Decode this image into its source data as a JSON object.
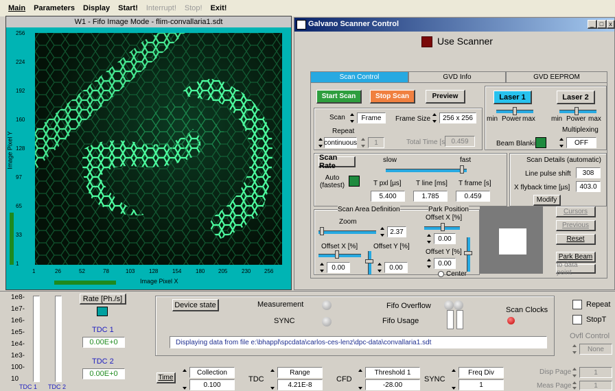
{
  "menu": {
    "items": [
      "Main",
      "Parameters",
      "Display",
      "Start!",
      "Interrupt!",
      "Stop!",
      "Exit!"
    ],
    "disabled": [
      false,
      false,
      false,
      false,
      true,
      true,
      false
    ]
  },
  "image_window": {
    "title": "W1 -  Fifo Image Mode - flim-convallaria1.sdt",
    "y_axis_label": "Image Pixel Y",
    "x_axis_label": "Image Pixel X",
    "y_ticks": [
      "256",
      "224",
      "192",
      "160",
      "128",
      "97",
      "65",
      "33",
      "1"
    ],
    "x_ticks": [
      "1",
      "26",
      "52",
      "78",
      "103",
      "128",
      "154",
      "180",
      "205",
      "230",
      "256"
    ]
  },
  "scanner_window": {
    "title": "Galvano Scanner Control",
    "use_scanner": "Use Scanner",
    "tabs": [
      "Scan Control",
      "GVD Info",
      "GVD EEPROM"
    ],
    "start_scan": "Start Scan",
    "stop_scan": "Stop Scan",
    "preview": "Preview",
    "scan_label": "Scan",
    "scan_mode": "Frame",
    "frame_size_label": "Frame Size",
    "frame_size": "256 x 256",
    "repeat_label": "Repeat",
    "repeat_mode": "continuous",
    "repeat_count": "1",
    "total_time_label": "Total Time [s]",
    "total_time": "0.459",
    "laser1": "Laser 1",
    "laser2": "Laser 2",
    "power_min": "min",
    "power_label": "Power",
    "power_max": "max",
    "multiplexing_label": "Multiplexing",
    "multiplexing": "OFF",
    "beam_blanking": "Beam Blanking",
    "scan_rate": "Scan Rate",
    "slow": "slow",
    "fast": "fast",
    "auto_label": "Auto\n(fastest)",
    "tpxl_label": "T pxl [µs]",
    "tline_label": "T line [ms]",
    "tframe_label": "T frame [s]",
    "tpxl": "5.400",
    "tline": "1.785",
    "tframe": "0.459",
    "scan_details_title": "Scan Details (automatic)",
    "line_pulse_shift_label": "Line pulse shift",
    "line_pulse_shift": "308",
    "xflyback_label": "X flyback time [µs]",
    "xflyback": "403.0",
    "modify": "Modify",
    "scan_area_title": "Scan Area Definition",
    "zoom_label": "Zoom",
    "zoom": "2.37",
    "offset_x_label": "Offset X [%]",
    "offset_y_label": "Offset Y [%]",
    "offset_x": "0.00",
    "offset_y": "0.00",
    "park_position_title": "Park Position",
    "park_offset_x_label": "Offset X [%]",
    "park_offset_x": "0.00",
    "park_offset_y_label": "Offset Y [%]",
    "park_offset_y": "0.00",
    "center_label": "Center",
    "cursors": "Cursors",
    "previous": "Previous",
    "reset": "Reset",
    "park_beam": "Park Beam",
    "to_data_point": "to data point"
  },
  "bottom": {
    "rate_ticks": [
      "1e8-",
      "1e7-",
      "1e6-",
      "1e5-",
      "1e4-",
      "1e3-",
      "100-",
      "10"
    ],
    "tdc1_label": "TDC 1",
    "tdc2_label": "TDC 2",
    "rate_label": "Rate [Ph./s]",
    "tdc1_value": "0.00E+0",
    "tdc2_value": "0.00E+0",
    "device_state": "Device state",
    "measurement": "Measurement",
    "sync": "SYNC",
    "fifo_overflow": "Fifo Overflow",
    "fifo_usage": "Fifo Usage",
    "scan_clocks": "Scan Clocks",
    "status_message": "Displaying data from file e:\\bhappl\\spcdata\\carlos-ces-lenz\\dpc-data\\convallaria1.sdt",
    "repeat": "Repeat",
    "stopt": "StopT",
    "ovfl_control_label": "Ovfl Control",
    "ovfl_control": "None",
    "time_label": "Time",
    "collection_label": "Collection",
    "collection_value": "0.100",
    "tdc_label": "TDC",
    "range_label": "Range",
    "range_value": "4.21E-8",
    "cfd_label": "CFD",
    "threshold_label": "Threshold 1",
    "threshold_value": "-28.00",
    "sync_label": "SYNC",
    "freq_div_label": "Freq Div",
    "freq_div_value": "1",
    "disp_page_label": "Disp Page",
    "disp_page": "1",
    "meas_page_label": "Meas Page",
    "meas_page": "1"
  }
}
